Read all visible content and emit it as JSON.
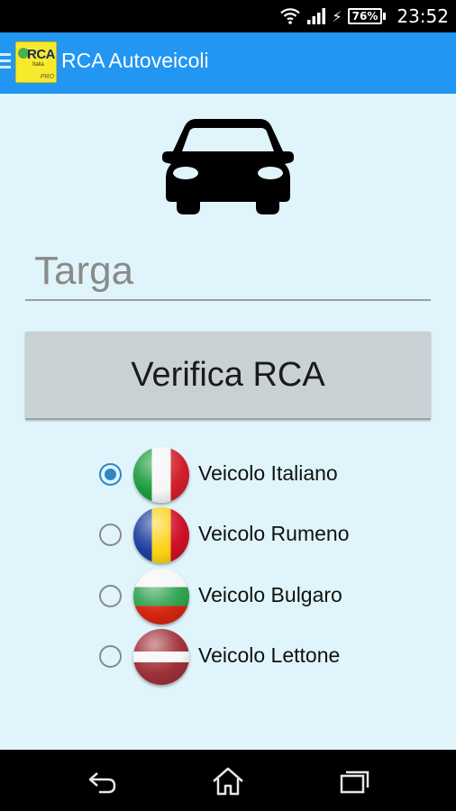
{
  "status_bar": {
    "battery": "76%",
    "time": "23:52",
    "icons": [
      "wifi-icon",
      "signal-icon",
      "charging-icon",
      "battery-icon"
    ]
  },
  "app_bar": {
    "title": "RCA Autoveicoli",
    "logo": {
      "text": "RCA",
      "subtext": "Italia",
      "badge": "PRO"
    },
    "color": "#2196f3"
  },
  "main": {
    "car_icon": "car-icon",
    "plate_input": {
      "placeholder": "Targa",
      "value": ""
    },
    "verify_button": "Verifica RCA",
    "vehicle_types": [
      {
        "label": "Veicolo Italiano",
        "flag": "italy-flag-icon",
        "selected": true
      },
      {
        "label": "Veicolo Rumeno",
        "flag": "romania-flag-icon",
        "selected": false
      },
      {
        "label": "Veicolo Bulgaro",
        "flag": "bulgaria-flag-icon",
        "selected": false
      },
      {
        "label": "Veicolo Lettone",
        "flag": "latvia-flag-icon",
        "selected": false
      }
    ]
  },
  "nav_bar": {
    "buttons": [
      "back-icon",
      "home-icon",
      "recents-icon"
    ]
  },
  "colors": {
    "background": "#e0f5fb",
    "accent": "#2f86c7",
    "button": "#c9d1d4"
  }
}
